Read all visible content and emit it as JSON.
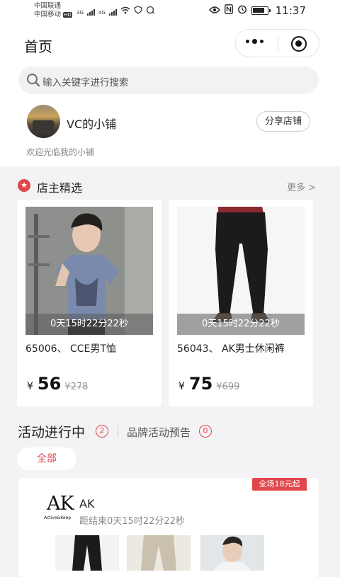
{
  "status_bar": {
    "carrier_1": "中国联通",
    "carrier_2": "中国移动",
    "hd_badge": "HD",
    "net_1": "3G",
    "net_2": "4G",
    "time": "11:37"
  },
  "nav": {
    "title": "首页",
    "menu_icon": "more-dots-icon",
    "close_icon": "target-circle-icon"
  },
  "search": {
    "placeholder": "输入关键字进行搜索"
  },
  "shop": {
    "name": "VC的小铺",
    "share_label": "分享店铺",
    "welcome": "欢迎光临我的小铺"
  },
  "featured": {
    "title": "店主精选",
    "more_label": "更多 >",
    "items": [
      {
        "name": "65006、 CCE男T恤",
        "countdown": "0天15时22分22秒",
        "currency": "¥",
        "price": "56",
        "original_price": "¥278"
      },
      {
        "name": "56043、 AK男士休闲裤",
        "countdown": "0天15时22分22秒",
        "currency": "¥",
        "price": "75",
        "original_price": "¥699"
      }
    ]
  },
  "activities": {
    "title": "活动进行中",
    "count": "2",
    "preview_title": "品牌活动预告",
    "preview_count": "0",
    "tab_all": "全部",
    "brand": {
      "ribbon": "全场18元起",
      "logo_text": "AK",
      "logo_sub": "Active&Keep",
      "name": "AK",
      "countdown": "距结束0天15时22分22秒"
    }
  },
  "colors": {
    "accent": "#e0474b",
    "background": "#f3f3f5"
  }
}
